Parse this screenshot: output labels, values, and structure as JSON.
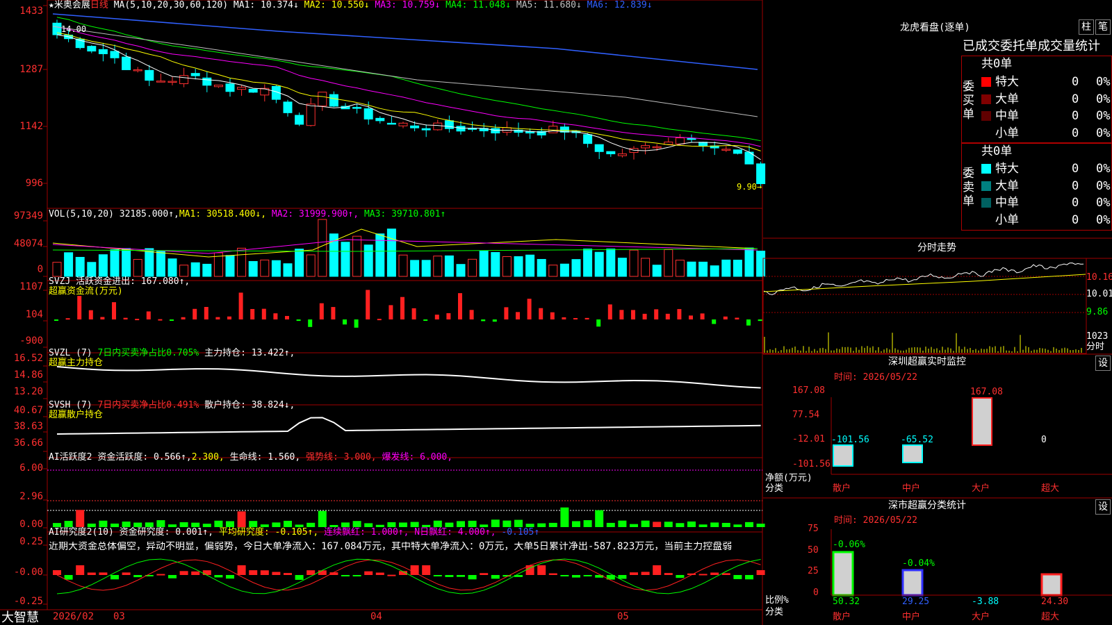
{
  "app": {
    "brand": "大智慧"
  },
  "main": {
    "stock_name": "米奥会展",
    "period": "日线",
    "ma_header": "MA(5,10,20,30,60,120)",
    "ma": [
      {
        "label": "MA1:",
        "value": "10.374↓",
        "color": "#ffffff"
      },
      {
        "label": "MA2:",
        "value": "10.550↓",
        "color": "#ffff00"
      },
      {
        "label": "MA3:",
        "value": "10.759↓",
        "color": "#ff00ff"
      },
      {
        "label": "MA4:",
        "value": "11.048↓",
        "color": "#00ff00"
      },
      {
        "label": "MA5:",
        "value": "11.680↓",
        "color": "#c0c0c0"
      },
      {
        "label": "MA6:",
        "value": "12.839↓",
        "color": "#3060ff"
      }
    ],
    "axis": [
      "1433",
      "1287",
      "1142",
      "996"
    ],
    "high_mark": "14.00",
    "low_mark": "9.90→"
  },
  "vol": {
    "header": "VOL(5,10,20)",
    "value": "32185.000↑,",
    "ma1": "MA1: 30518.400↓,",
    "ma2": "MA2: 31999.900↑,",
    "ma3": "MA3: 39710.801↑",
    "axis": [
      "97349",
      "48074",
      "0"
    ]
  },
  "svzj": {
    "header": "SVZJ  活跃资金进出: 167.080↑,",
    "sub": "超赢资金流(万元)",
    "axis": [
      "1107",
      "104",
      "-900"
    ]
  },
  "svzl": {
    "header": "SVZL (7)",
    "part2": "7日内买卖净占比0.705%",
    "part3": "主力持仓: 13.422↑,",
    "sub": "超赢主力持仓",
    "axis": [
      "16.52",
      "14.86",
      "13.20"
    ]
  },
  "svsh": {
    "header": "SVSH (7)",
    "part2": "7日内买卖净占比0.491%",
    "part3": "散户持仓: 38.824↓,",
    "sub": "超赢散户持仓",
    "axis": [
      "40.67",
      "38.63",
      "36.66"
    ]
  },
  "ai2": {
    "header": "AI活跃度2",
    "p1": "资金活跃度: 0.566↑,",
    "p2": "2.300,",
    "p3": "生命线: 1.560,",
    "p4": "强势线: 3.000,",
    "p5": "爆发线: 6.000,",
    "axis": [
      "6.00",
      "2.96",
      "0.00"
    ]
  },
  "research": {
    "header": "AI研究度2(10)",
    "p1": "资金研究度: 0.001↑,",
    "p2": "平均研究度: -0.105↑,",
    "p3": "连续飘红: 1.000↑,",
    "p4": "N日飘红: 4.000↑,",
    "p5": "-0.105↑",
    "comment": "近期大资金总体偏空，异动不明显，偏弱势，今日大单净流入：167.084万元，其中特大单净流入：0万元，大单5日累计净出-587.823万元，当前主力控盘弱",
    "axis": [
      "0.25",
      "-0.00",
      "-0.25"
    ]
  },
  "xaxis": [
    "2026/02",
    "03",
    "04",
    "05"
  ],
  "right": {
    "title": "龙虎看盘(逐单)",
    "btn1": "柱",
    "btn2": "笔",
    "stat_title": "已成交委托单成交量统计",
    "buy": {
      "side": "委买单",
      "total": "共0单",
      "rows": [
        {
          "label": "特大",
          "value": "0",
          "pct": "0%",
          "color": "#ff0000"
        },
        {
          "label": "大单",
          "value": "0",
          "pct": "0%",
          "color": "#800000"
        },
        {
          "label": "中单",
          "value": "0",
          "pct": "0%",
          "color": "#600000"
        },
        {
          "label": "小单",
          "value": "0",
          "pct": "0%",
          "color": "#000000"
        }
      ]
    },
    "sell": {
      "side": "委卖单",
      "total": "共0单",
      "rows": [
        {
          "label": "特大",
          "value": "0",
          "pct": "0%",
          "color": "#00ffff"
        },
        {
          "label": "大单",
          "value": "0",
          "pct": "0%",
          "color": "#008080"
        },
        {
          "label": "中单",
          "value": "0",
          "pct": "0%",
          "color": "#006060"
        },
        {
          "label": "小单",
          "value": "0",
          "pct": "0%",
          "color": "#000000"
        }
      ]
    },
    "intraday_title": "分时走势",
    "intraday_axis": [
      "10.16",
      "10.01",
      "9.86"
    ],
    "intraday_vol": "1023",
    "intraday_vol_label": "分时",
    "monitor_title": "深圳超赢实时监控",
    "monitor_btn": "设",
    "monitor_time": "时间: 2026/05/22",
    "monitor_axis": [
      "167.08",
      "77.54",
      "-12.01",
      "-101.56"
    ],
    "monitor_ylabel": "净额(万元)",
    "monitor_xlabel": "分类",
    "monitor_values": [
      "-101.56",
      "-65.52",
      "167.08",
      "0"
    ],
    "categories": [
      "散户",
      "中户",
      "大户",
      "超大"
    ],
    "class_title": "深市超赢分类统计",
    "class_btn": "设",
    "class_time": "时间: 2026/05/22",
    "class_axis": [
      "75",
      "50",
      "25",
      "0"
    ],
    "class_tops": [
      "-0.06%",
      "-0.04%",
      "",
      ""
    ],
    "class_values": [
      "50.32",
      "29.25",
      "-3.88",
      "24.30"
    ],
    "class_ylabel": "比例%",
    "class_xlabel": "分类"
  },
  "chart_data": [
    {
      "type": "candlestick",
      "title": "米奥会展 日线",
      "ylim": [
        9.96,
        14.33
      ],
      "high": 14.0,
      "low": 9.9,
      "ma_latest": {
        "MA5": 10.374,
        "MA10": 10.55,
        "MA20": 10.759,
        "MA30": 11.048,
        "MA60": 11.68,
        "MA120": 12.839
      }
    },
    {
      "type": "bar",
      "title": "VOL(5,10,20)",
      "ylim": [
        0,
        97349
      ],
      "latest": 32185.0,
      "ma_latest": {
        "MA1": 30518.4,
        "MA2": 31999.9,
        "MA3": 39710.801
      }
    },
    {
      "type": "bar",
      "title": "SVZJ 活跃资金进出",
      "ylim": [
        -900,
        1107
      ],
      "latest": 167.08
    },
    {
      "type": "line",
      "title": "SVZL 主力持仓",
      "ylim": [
        13.2,
        16.52
      ],
      "latest": 13.422
    },
    {
      "type": "line",
      "title": "SVSH 散户持仓",
      "ylim": [
        36.66,
        40.67
      ],
      "latest": 38.824
    },
    {
      "type": "bar",
      "title": "AI活跃度2",
      "ylim": [
        0,
        6
      ],
      "latest": 0.566,
      "lines": {
        "生命线": 1.56,
        "强势线": 3.0,
        "爆发线": 6.0
      }
    },
    {
      "type": "bar",
      "title": "AI研究度2(10)",
      "ylim": [
        -0.25,
        0.25
      ],
      "latest": 0.001,
      "average": -0.105
    },
    {
      "type": "bar",
      "title": "深圳超赢实时监控",
      "categories": [
        "散户",
        "中户",
        "大户",
        "超大"
      ],
      "values": [
        -101.56,
        -65.52,
        167.08,
        0
      ],
      "ylim": [
        -101.56,
        167.08
      ]
    },
    {
      "type": "bar",
      "title": "深市超赢分类统计",
      "categories": [
        "散户",
        "中户",
        "大户",
        "超大"
      ],
      "values": [
        50.32,
        29.25,
        -3.88,
        24.3
      ],
      "ylim": [
        0,
        75
      ]
    }
  ]
}
